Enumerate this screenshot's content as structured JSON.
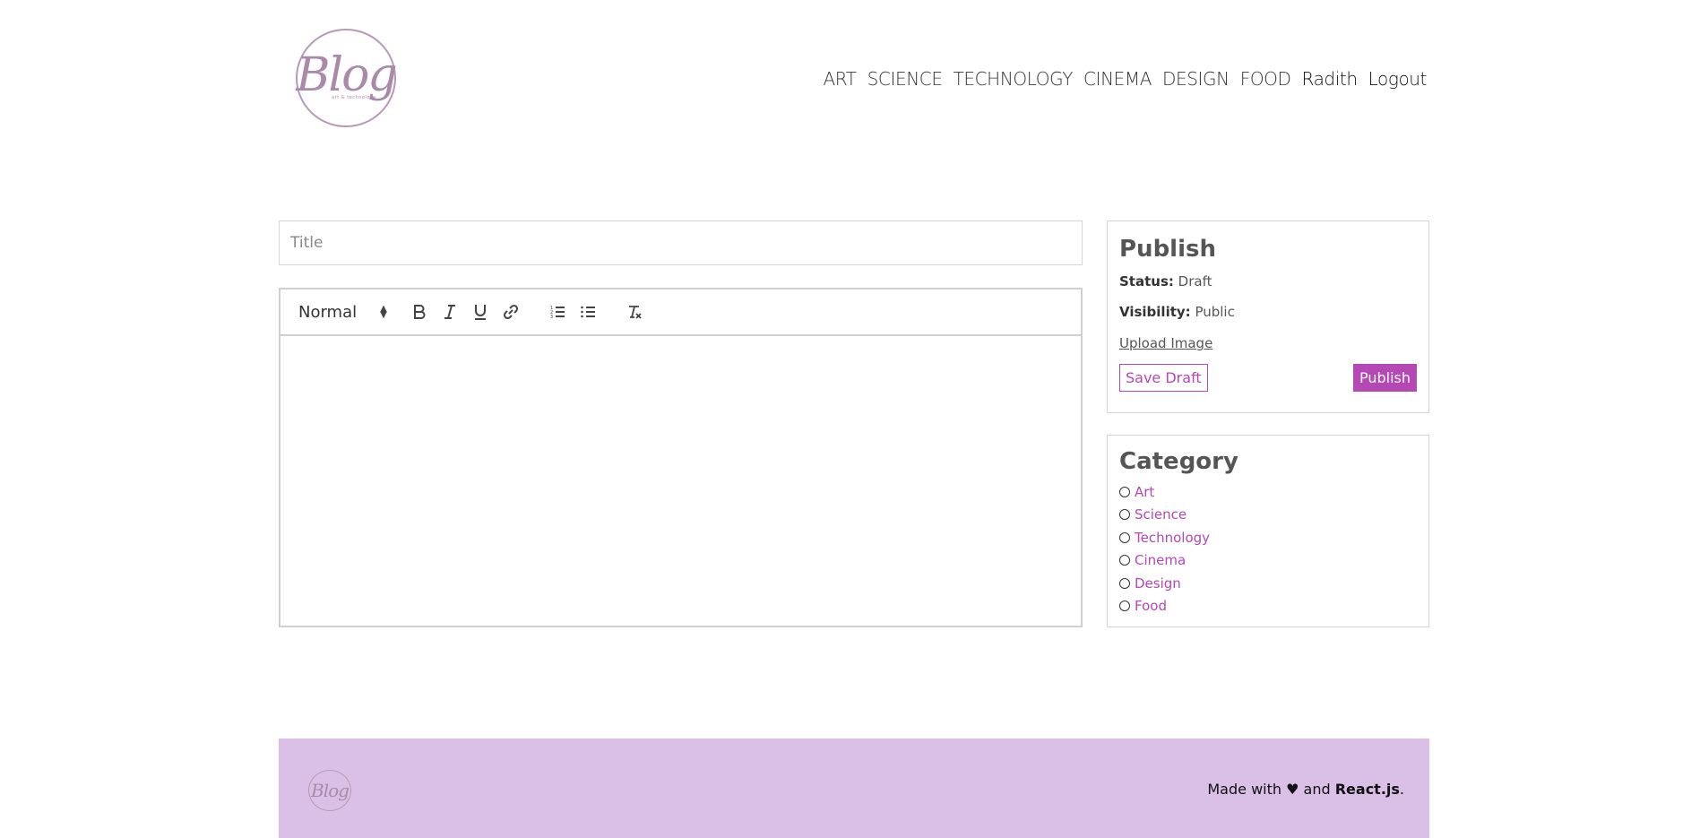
{
  "header": {
    "logo_text": "Blog",
    "logo_subtext": "art & technology",
    "nav": [
      "ART",
      "SCIENCE",
      "TECHNOLOGY",
      "CINEMA",
      "DESIGN",
      "FOOD"
    ],
    "user": "Radith",
    "logout": "Logout"
  },
  "editor": {
    "title_placeholder": "Title",
    "title_value": "",
    "toolbar": {
      "heading_select": "Normal",
      "heading_arrows_up": "▲",
      "heading_arrows_down": "▼",
      "bold": "B",
      "italic": "I",
      "underline": "U",
      "link_icon": "link-icon",
      "ordered_list_icon": "ordered-list-icon",
      "bullet_list_icon": "bullet-list-icon",
      "clean_icon": "clear-format-icon"
    },
    "content": ""
  },
  "publish": {
    "heading": "Publish",
    "status_label": "Status:",
    "status_value": "Draft",
    "visibility_label": "Visibility:",
    "visibility_value": "Public",
    "upload_label": "Upload Image",
    "save_draft_label": "Save Draft",
    "publish_label": "Publish"
  },
  "category": {
    "heading": "Category",
    "items": [
      "Art",
      "Science",
      "Technology",
      "Cinema",
      "Design",
      "Food"
    ]
  },
  "footer": {
    "logo_text": "Blog",
    "made_with": "Made with ♥ and ",
    "react": "React.js",
    "period": "."
  },
  "colors": {
    "accent": "#b548b5",
    "footer_bg": "#dac0e6",
    "logo": "#a98aa9"
  }
}
